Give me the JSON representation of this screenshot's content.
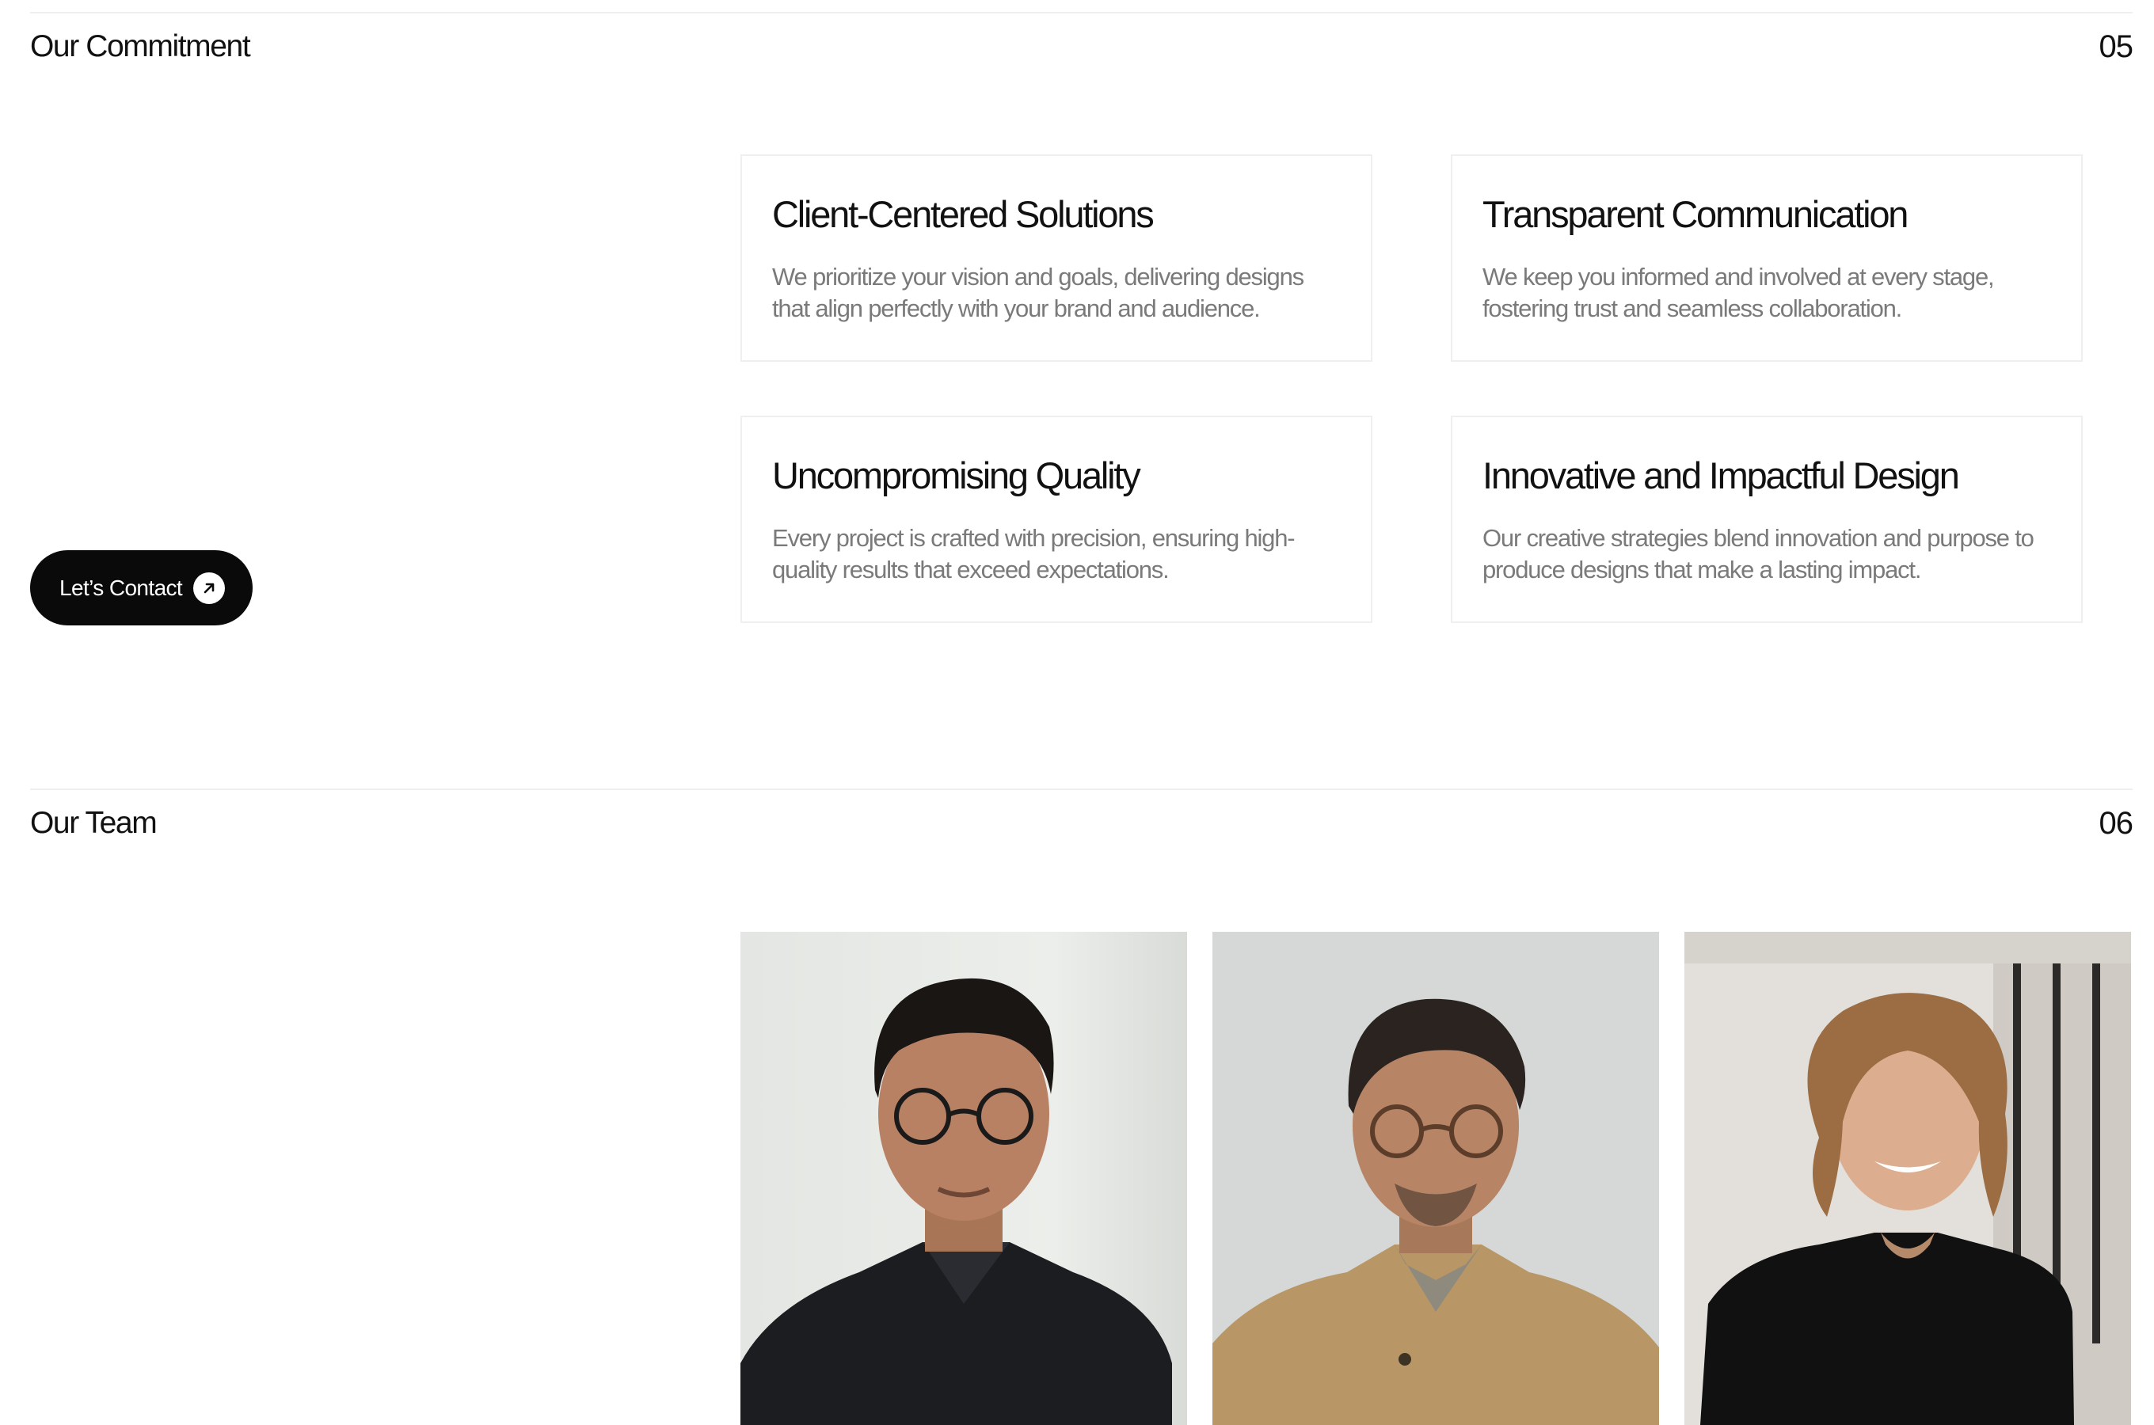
{
  "commitment": {
    "title": "Our Commitment",
    "number": "05",
    "cards": [
      {
        "title": "Client-Centered Solutions",
        "body": "We prioritize your vision and goals, delivering designs that align perfectly with your brand and audience."
      },
      {
        "title": "Transparent Communication",
        "body": "We keep you informed and involved at every stage, fostering trust and seamless collaboration."
      },
      {
        "title": "Uncompromising Quality",
        "body": "Every project is crafted with precision, ensuring high-quality results that exceed expectations."
      },
      {
        "title": "Innovative and Impactful Design",
        "body": "Our creative strategies blend innovation and purpose to produce designs that make a lasting impact."
      }
    ],
    "cta": {
      "label": "Let’s Contact",
      "icon": "arrow-up-right-icon"
    }
  },
  "team": {
    "title": "Our Team",
    "number": "06",
    "members": [
      {
        "portrait": "man with glasses in black shirt"
      },
      {
        "portrait": "man with glasses in tan jacket"
      },
      {
        "portrait": "woman with curly hair in black top"
      }
    ]
  },
  "colors": {
    "accent": "#0a0a0a",
    "muted_text": "#7a7a7a",
    "border": "#efefef"
  }
}
